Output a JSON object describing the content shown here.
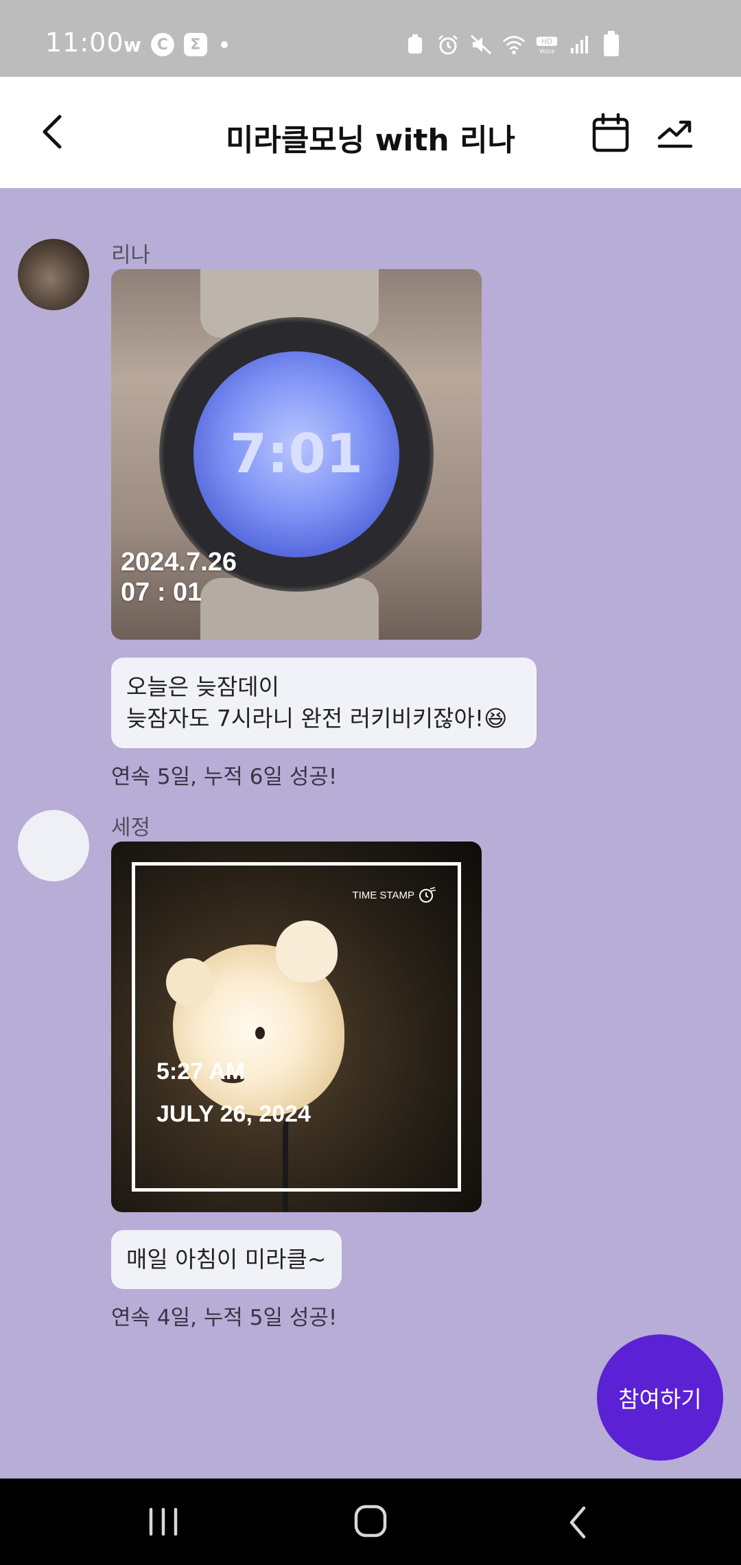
{
  "status_bar": {
    "time": "11:00",
    "left_icons": [
      "w-icon",
      "c-circle-icon",
      "sigma-icon",
      "dot-icon"
    ],
    "right_icons": [
      "recycle-icon",
      "alarm-icon",
      "mute-icon",
      "wifi-icon",
      "hd-voice-icon",
      "signal-icon",
      "battery-icon"
    ]
  },
  "header": {
    "title": "미라클모닝 with 리나"
  },
  "messages": [
    {
      "author": "리나",
      "photo_stamp_date": "2024.7.26",
      "photo_stamp_time": "07 : 01",
      "watch_time": "7:01",
      "text_line1": "오늘은 늦잠데이",
      "text_line2": "늦잠자도 7시라니 완전 러키비키잖아!😆",
      "streak": "연속 5일, 누적 6일 성공!"
    },
    {
      "author": "세정",
      "photo_stamp_label": "TIME STAMP",
      "photo_stamp_time": "5:27 AM",
      "photo_stamp_date": "JULY 26, 2024",
      "text": "매일 아침이 미라클~",
      "streak": "연속 4일, 누적 5일 성공!"
    }
  ],
  "join_button": {
    "label": "참여하기",
    "color": "#5a22d4"
  },
  "colors": {
    "chat_background": "#b8add6",
    "bubble": "#f1f2f7",
    "status_bar": "#bcbcbc"
  }
}
